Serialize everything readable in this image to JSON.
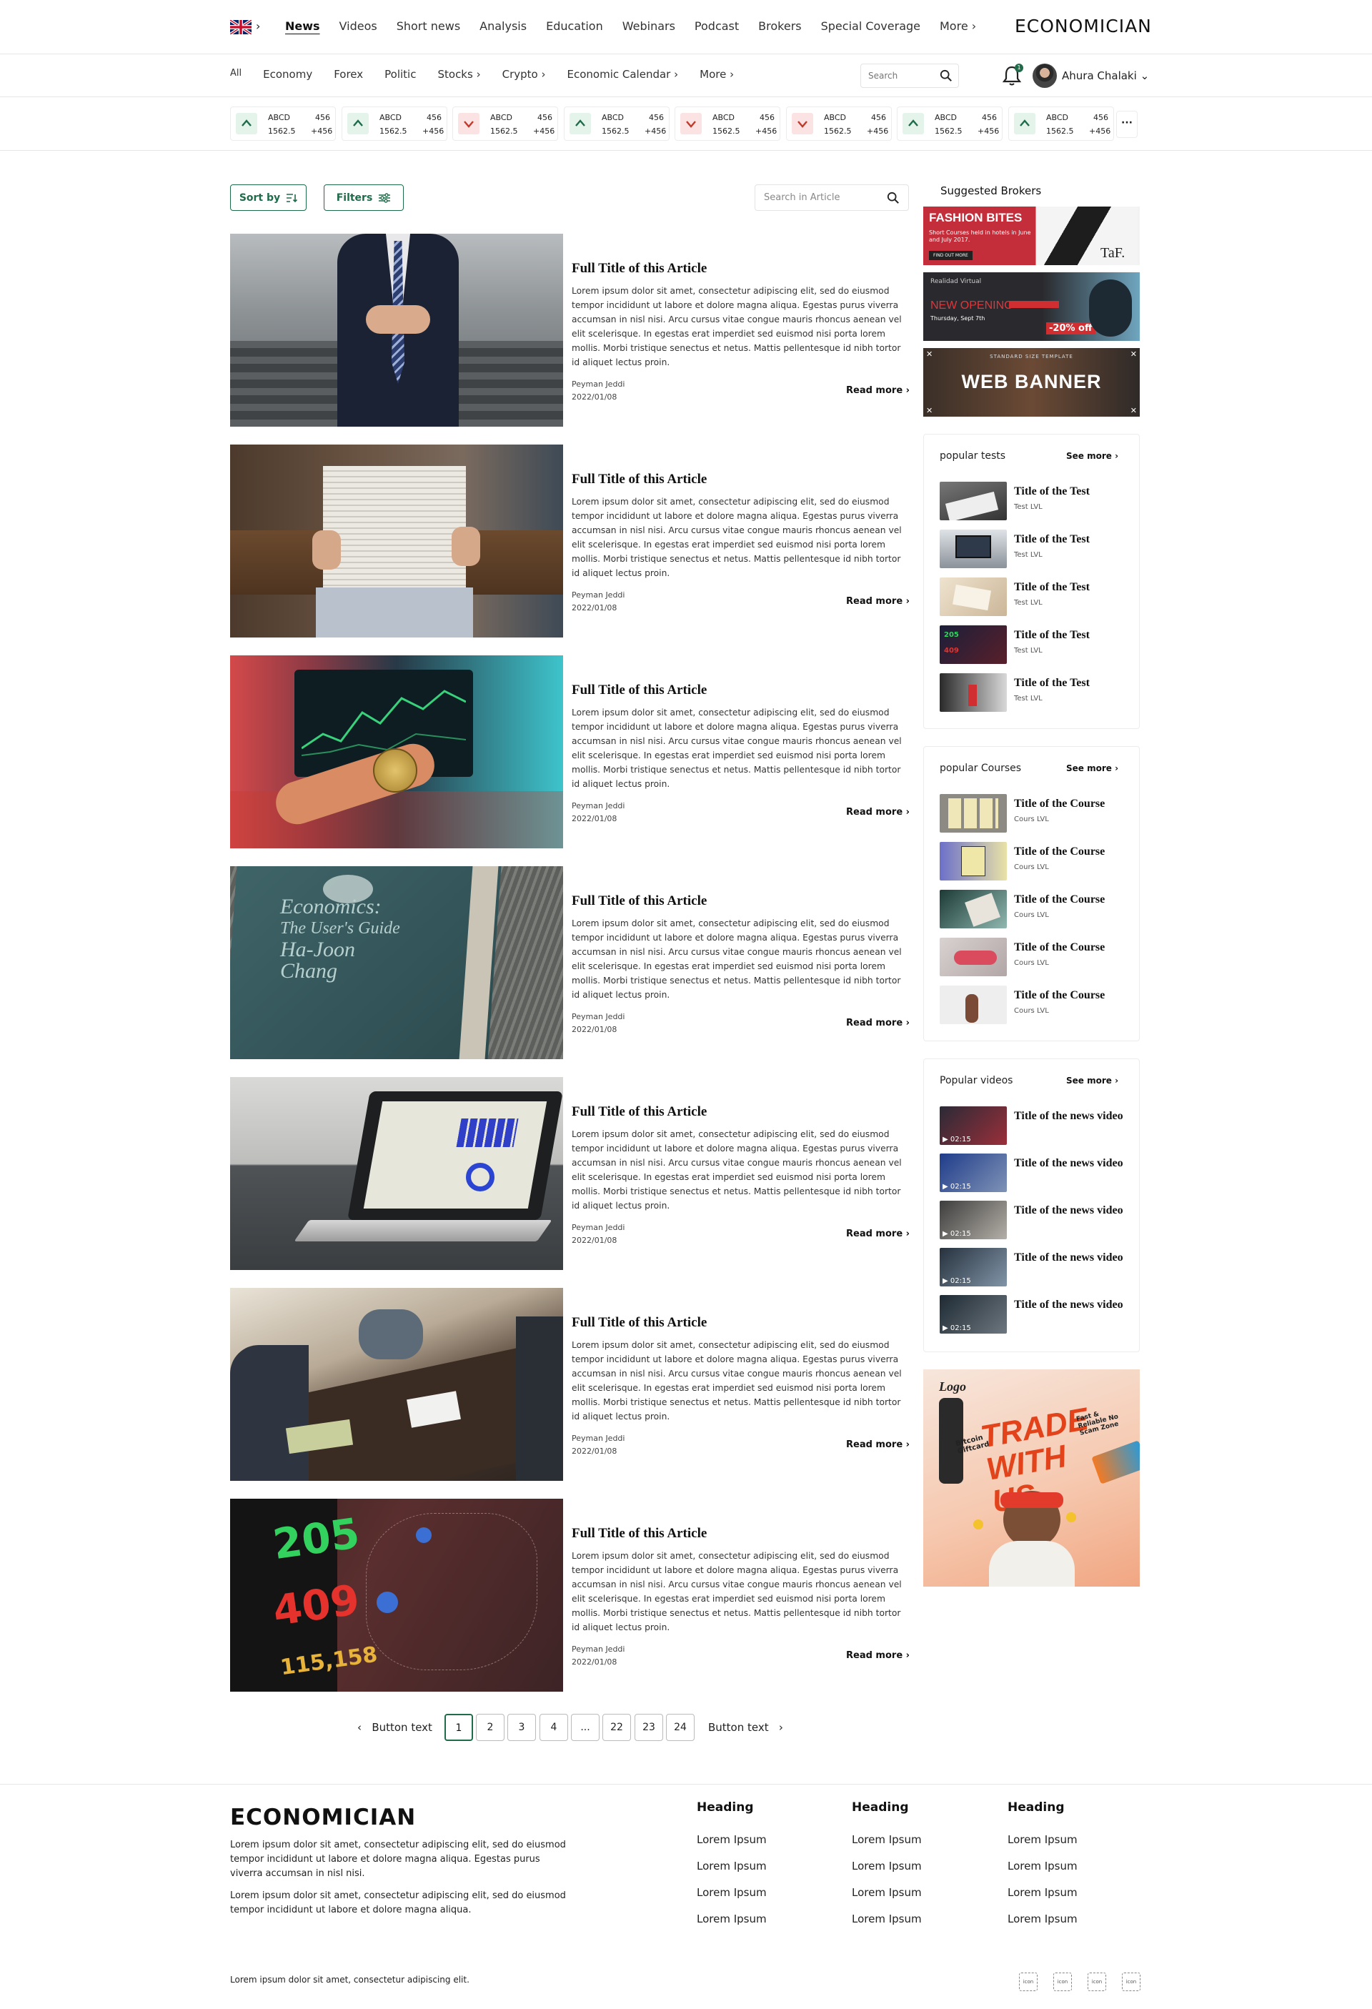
{
  "brand": "ECONOMICIAN",
  "topnav": {
    "items": [
      "News",
      "Videos",
      "Short news",
      "Analysis",
      "Education",
      "Webinars",
      "Podcast",
      "Brokers",
      "Special Coverage",
      "More"
    ]
  },
  "subnav": {
    "items": [
      "All",
      "Economy",
      "Forex",
      "Politic",
      "Stocks",
      "Crypto",
      "Economic Calendar",
      "More"
    ],
    "search_placeholder": "Search",
    "notification_count": "1",
    "user_name": "Ahura Chalaki"
  },
  "ticker": [
    {
      "symbol": "ABCD",
      "price": "1562.5",
      "value": "456",
      "change": "+456",
      "direction": "up"
    },
    {
      "symbol": "ABCD",
      "price": "1562.5",
      "value": "456",
      "change": "+456",
      "direction": "up"
    },
    {
      "symbol": "ABCD",
      "price": "1562.5",
      "value": "456",
      "change": "+456",
      "direction": "down"
    },
    {
      "symbol": "ABCD",
      "price": "1562.5",
      "value": "456",
      "change": "+456",
      "direction": "up"
    },
    {
      "symbol": "ABCD",
      "price": "1562.5",
      "value": "456",
      "change": "+456",
      "direction": "down"
    },
    {
      "symbol": "ABCD",
      "price": "1562.5",
      "value": "456",
      "change": "+456",
      "direction": "down"
    },
    {
      "symbol": "ABCD",
      "price": "1562.5",
      "value": "456",
      "change": "+456",
      "direction": "up"
    },
    {
      "symbol": "ABCD",
      "price": "1562.5",
      "value": "456",
      "change": "+456",
      "direction": "up"
    }
  ],
  "controls": {
    "sort_label": "Sort by",
    "filters_label": "Filters",
    "search_placeholder": "Search in Article"
  },
  "articles": [
    {
      "title": "Full Title of this Article",
      "body": "Lorem ipsum dolor sit amet, consectetur adipiscing elit, sed do eiusmod tempor incididunt ut labore et dolore magna aliqua. Egestas purus viverra accumsan in nisl nisi. Arcu cursus vitae congue mauris rhoncus aenean vel elit scelerisque. In egestas erat imperdiet sed euismod nisi porta lorem mollis. Morbi tristique senectus et netus. Mattis pellentesque id nibh tortor id aliquet lectus proin.",
      "author": "Peyman Jeddi",
      "date": "2022/01/08",
      "read_more": "Read more"
    },
    {
      "title": "Full Title of this Article",
      "body": "Lorem ipsum dolor sit amet, consectetur adipiscing elit, sed do eiusmod tempor incididunt ut labore et dolore magna aliqua. Egestas purus viverra accumsan in nisl nisi. Arcu cursus vitae congue mauris rhoncus aenean vel elit scelerisque. In egestas erat imperdiet sed euismod nisi porta lorem mollis. Morbi tristique senectus et netus. Mattis pellentesque id nibh tortor id aliquet lectus proin.",
      "author": "Peyman Jeddi",
      "date": "2022/01/08",
      "read_more": "Read more"
    },
    {
      "title": "Full Title of this Article",
      "body": "Lorem ipsum dolor sit amet, consectetur adipiscing elit, sed do eiusmod tempor incididunt ut labore et dolore magna aliqua. Egestas purus viverra accumsan in nisl nisi. Arcu cursus vitae congue mauris rhoncus aenean vel elit scelerisque. In egestas erat imperdiet sed euismod nisi porta lorem mollis. Morbi tristique senectus et netus. Mattis pellentesque id nibh tortor id aliquet lectus proin.",
      "author": "Peyman Jeddi",
      "date": "2022/01/08",
      "read_more": "Read more"
    },
    {
      "title": "Full Title of this Article",
      "body": "Lorem ipsum dolor sit amet, consectetur adipiscing elit, sed do eiusmod tempor incididunt ut labore et dolore magna aliqua. Egestas purus viverra accumsan in nisl nisi. Arcu cursus vitae congue mauris rhoncus aenean vel elit scelerisque. In egestas erat imperdiet sed euismod nisi porta lorem mollis. Morbi tristique senectus et netus. Mattis pellentesque id nibh tortor id aliquet lectus proin.",
      "author": "Peyman Jeddi",
      "date": "2022/01/08",
      "read_more": "Read more"
    },
    {
      "title": "Full Title of this Article",
      "body": "Lorem ipsum dolor sit amet, consectetur adipiscing elit, sed do eiusmod tempor incididunt ut labore et dolore magna aliqua. Egestas purus viverra accumsan in nisl nisi. Arcu cursus vitae congue mauris rhoncus aenean vel elit scelerisque. In egestas erat imperdiet sed euismod nisi porta lorem mollis. Morbi tristique senectus et netus. Mattis pellentesque id nibh tortor id aliquet lectus proin.",
      "author": "Peyman Jeddi",
      "date": "2022/01/08",
      "read_more": "Read more"
    },
    {
      "title": "Full Title of this Article",
      "body": "Lorem ipsum dolor sit amet, consectetur adipiscing elit, sed do eiusmod tempor incididunt ut labore et dolore magna aliqua. Egestas purus viverra accumsan in nisl nisi. Arcu cursus vitae congue mauris rhoncus aenean vel elit scelerisque. In egestas erat imperdiet sed euismod nisi porta lorem mollis. Morbi tristique senectus et netus. Mattis pellentesque id nibh tortor id aliquet lectus proin.",
      "author": "Peyman Jeddi",
      "date": "2022/01/08",
      "read_more": "Read more"
    },
    {
      "title": "Full Title of this Article",
      "body": "Lorem ipsum dolor sit amet, consectetur adipiscing elit, sed do eiusmod tempor incididunt ut labore et dolore magna aliqua. Egestas purus viverra accumsan in nisl nisi. Arcu cursus vitae congue mauris rhoncus aenean vel elit scelerisque. In egestas erat imperdiet sed euismod nisi porta lorem mollis. Morbi tristique senectus et netus. Mattis pellentesque id nibh tortor id aliquet lectus proin.",
      "author": "Peyman Jeddi",
      "date": "2022/01/08",
      "read_more": "Read more"
    }
  ],
  "article_images": {
    "book_title": [
      "Economics:",
      "The User's Guide",
      "Ha-Joon",
      "Chang"
    ],
    "monitor_numbers": [
      "205",
      "409",
      "115,158"
    ]
  },
  "pagination": {
    "prev_label": "Button text",
    "next_label": "Button text",
    "pages": [
      "1",
      "2",
      "3",
      "4",
      "...",
      "22",
      "23",
      "24"
    ],
    "current": "1"
  },
  "sidebar": {
    "brokers_title": "Suggested Brokers",
    "ads": {
      "fashion_title": "FASHION BITES",
      "fashion_text": "Short Courses held in hotels in June and July 2017.",
      "fashion_cta": "FIND OUT MORE",
      "opening_brand": "Realidad Virtual",
      "opening_title": "NEW OPENING",
      "opening_date": "Thursday, Sept 7th",
      "opening_discount": "-20% off",
      "web_banner_top": "STANDARD SIZE TEMPLATE",
      "web_banner": "WEB BANNER",
      "trade_logo": "Logo",
      "trade_text": "TRADE WITH US",
      "trade_tag1": "Bitcoin Giftcard",
      "trade_tag2": "Fast & Reliable No Scam Zone"
    },
    "tests": {
      "heading": "popular tests",
      "see_more": "See more",
      "items": [
        {
          "title": "Title of the Test",
          "level": "Test LVL"
        },
        {
          "title": "Title of the Test",
          "level": "Test LVL"
        },
        {
          "title": "Title of the Test",
          "level": "Test LVL"
        },
        {
          "title": "Title of the Test",
          "level": "Test LVL"
        },
        {
          "title": "Title of the Test",
          "level": "Test LVL"
        }
      ]
    },
    "courses": {
      "heading": "popular Courses",
      "see_more": "See more",
      "items": [
        {
          "title": "Title of the Course",
          "level": "Cours LVL"
        },
        {
          "title": "Title of the Course",
          "level": "Cours LVL"
        },
        {
          "title": "Title of the Course",
          "level": "Cours LVL"
        },
        {
          "title": "Title of the Course",
          "level": "Cours LVL"
        },
        {
          "title": "Title of the Course",
          "level": "Cours LVL"
        }
      ]
    },
    "videos": {
      "heading": "Popular videos",
      "see_more": "See more",
      "items": [
        {
          "title": "Title of the news video",
          "duration": "02:15"
        },
        {
          "title": "Title of the news video",
          "duration": "02:15"
        },
        {
          "title": "Title of the news video",
          "duration": "02:15"
        },
        {
          "title": "Title of the news video",
          "duration": "02:15"
        },
        {
          "title": "Title of the news video",
          "duration": "02:15"
        }
      ]
    }
  },
  "footer": {
    "brand": "ECONOMICIAN",
    "para1": "Lorem ipsum dolor sit amet, consectetur adipiscing elit, sed do eiusmod tempor incididunt ut labore et dolore magna aliqua. Egestas purus viverra accumsan in nisl nisi.",
    "para2": "Lorem ipsum dolor sit amet, consectetur adipiscing elit, sed do eiusmod tempor incididunt ut labore et dolore magna aliqua.",
    "columns": [
      {
        "heading": "Heading",
        "links": [
          "Lorem Ipsum",
          "Lorem Ipsum",
          "Lorem Ipsum",
          "Lorem Ipsum"
        ]
      },
      {
        "heading": "Heading",
        "links": [
          "Lorem Ipsum",
          "Lorem Ipsum",
          "Lorem Ipsum",
          "Lorem Ipsum"
        ]
      },
      {
        "heading": "Heading",
        "links": [
          "Lorem Ipsum",
          "Lorem Ipsum",
          "Lorem Ipsum",
          "Lorem Ipsum"
        ]
      }
    ],
    "copyright": "Lorem ipsum dolor sit amet, consectetur adipiscing elit.",
    "social_icon_label": "icon"
  },
  "colors": {
    "accent": "#1f6b4a",
    "up_bg": "#e4f4ea",
    "down_bg": "#fbe3e3",
    "up_arrow": "#1f6b4a",
    "down_arrow": "#c0392b"
  }
}
